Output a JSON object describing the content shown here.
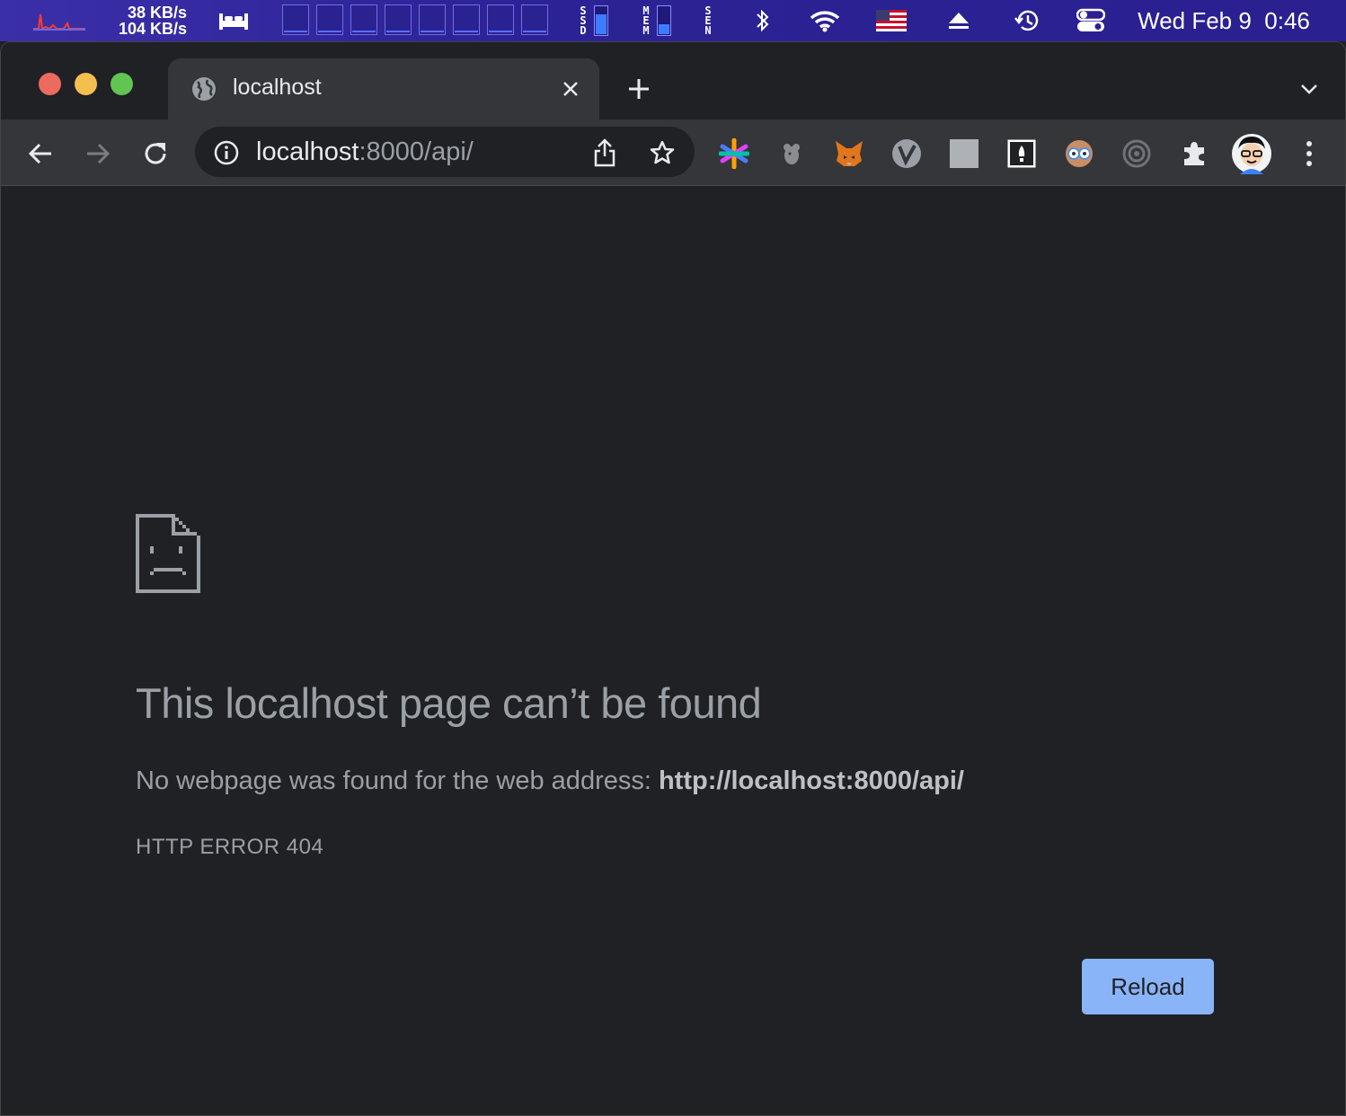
{
  "menubar": {
    "net_up": "38 KB/s",
    "net_down": "104 KB/s",
    "ssd_label": "S\nS\nD",
    "mem_label": "M\nE\nM",
    "sen_label": "S\nE\nN",
    "ssd_fill": 0.7,
    "mem_fill": 0.35,
    "clock": "Wed Feb 9  0:46",
    "icons": [
      "network-graph-icon",
      "sleep-bed-icon",
      "cpu-meter-icon",
      "ssd-meter-icon",
      "memory-meter-icon",
      "sensors-icon",
      "bluetooth-icon",
      "wifi-icon",
      "us-flag-icon",
      "eject-icon",
      "time-machine-icon",
      "control-center-icon"
    ]
  },
  "browser": {
    "tab_title": "localhost",
    "url_host": "localhost",
    "url_rest": ":8000/api/",
    "extensions": [
      "colorful-asterisk-extension-icon",
      "mouse-extension-icon",
      "metamask-fox-icon",
      "v-circle-extension-icon",
      "gray-square-extension-icon",
      "rocket-box-extension-icon",
      "glasses-face-extension-icon",
      "camera-lens-extension-icon",
      "puzzle-extensions-icon"
    ]
  },
  "page": {
    "title": "This localhost page can’t be found",
    "description_prefix": "No webpage was found for the web address: ",
    "description_url": "http://localhost:8000/api/",
    "error_code": "HTTP ERROR 404",
    "reload_label": "Reload"
  },
  "colors": {
    "menubar": "#2b2295",
    "page_bg": "#202124",
    "text_muted": "#9aa0a6",
    "button": "#8ab4f8",
    "close_light": "#ed6a5e",
    "minimize_light": "#f5bf4f",
    "zoom_light": "#61c554"
  }
}
